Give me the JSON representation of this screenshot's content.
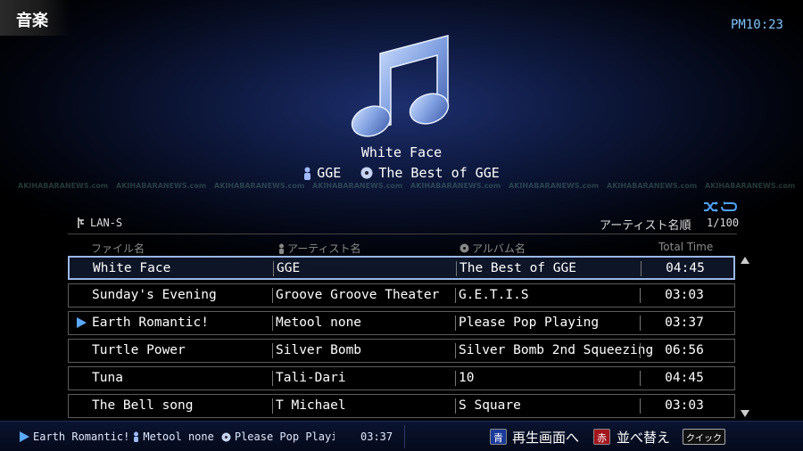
{
  "app": {
    "mode_label": "音楽",
    "clock": "PM10:23"
  },
  "now_playing_display": {
    "title": "White Face",
    "artist": "GGE",
    "album": "The Best of GGE"
  },
  "watermark": "AKIHABARANEWS.com",
  "list_header": {
    "source": "LAN-S",
    "sort_label": "アーティスト名順",
    "count": "1/100"
  },
  "columns": {
    "file": "ファイル名",
    "artist": "アーティスト名",
    "album": "アルバム名",
    "time": "Total Time"
  },
  "rows": [
    {
      "file": "White Face",
      "artist": "GGE",
      "album": "The Best of GGE",
      "time": "04:45"
    },
    {
      "file": "Sunday's Evening",
      "artist": "Groove Groove Theater",
      "album": "G.E.T.I.S",
      "time": "03:03"
    },
    {
      "file": "Earth Romantic!",
      "artist": "Metool none",
      "album": "Please Pop Playing",
      "time": "03:37"
    },
    {
      "file": "Turtle Power",
      "artist": "Silver Bomb",
      "album": "Silver Bomb 2nd Squeezing",
      "time": "06:56"
    },
    {
      "file": "Tuna",
      "artist": "Tali-Dari",
      "album": "10",
      "time": "04:45"
    },
    {
      "file": "The Bell song",
      "artist": "T Michael",
      "album": "S Square",
      "time": "03:03"
    }
  ],
  "selected_row": 0,
  "playing_row": 2,
  "footer": {
    "track": "Earth Romantic!",
    "artist": "Metool none",
    "album": "Please Pop Playing",
    "time": "03:37",
    "blue_key": "青",
    "blue_label": "再生画面へ",
    "red_key": "赤",
    "red_label": "並べ替え",
    "quick_key": "クイック"
  },
  "colors": {
    "accent_blue": "#7fc4ff",
    "selected_border": "#9ab8e8",
    "key_blue": "#1a3a9a",
    "key_red": "#a3141c"
  }
}
